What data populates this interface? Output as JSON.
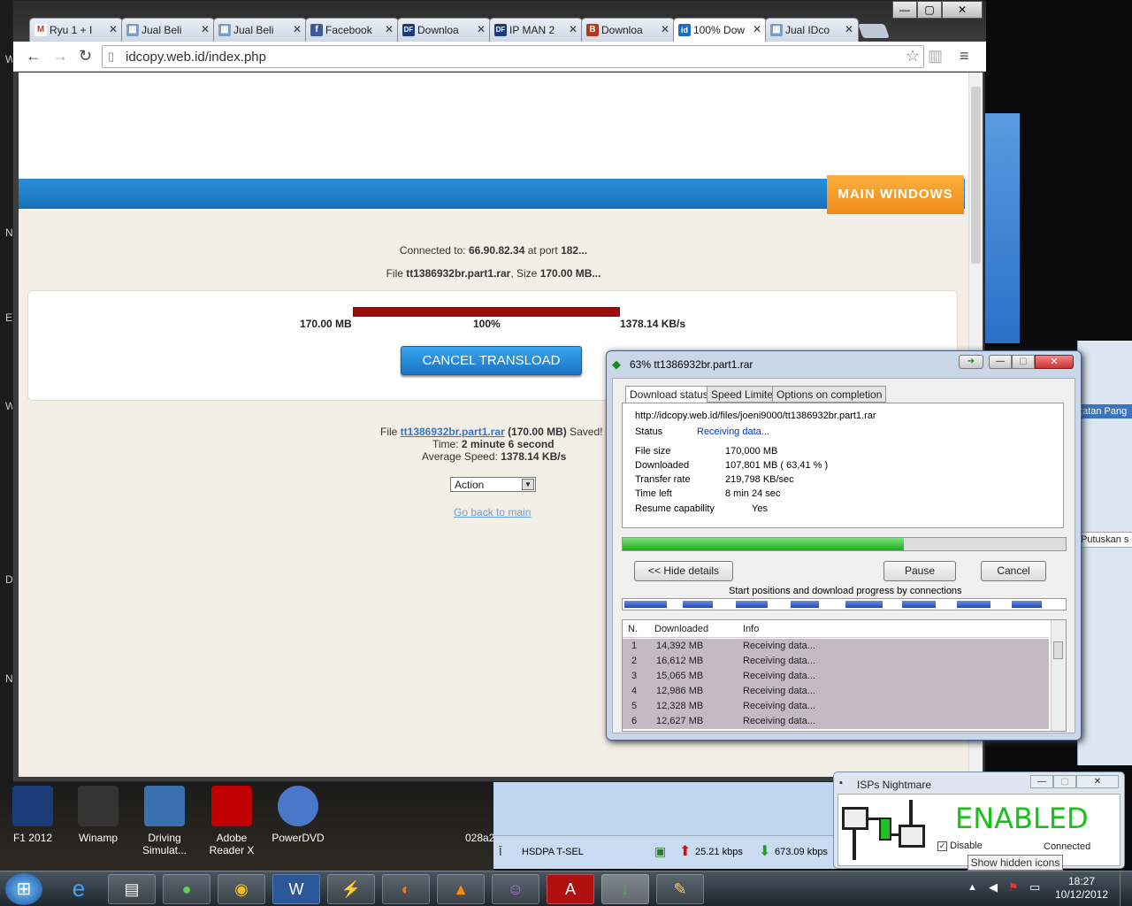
{
  "desktop": {
    "side_letters": [
      "W",
      "N",
      "E",
      "W",
      "D",
      "N"
    ],
    "right_strip": {
      "text1": "tatan Pang",
      "text2": "Putuskan s"
    },
    "icons": [
      {
        "label": "F1 2012",
        "icon": "f1-2012-icon",
        "color": "#1b3c78"
      },
      {
        "label": "Winamp",
        "icon": "winamp-icon",
        "color": "#333"
      },
      {
        "label": "Driving Simulat...",
        "icon": "driving-simulator-icon",
        "color": "#3a6fb0"
      },
      {
        "label": "Adobe Reader X",
        "icon": "adobe-reader-icon",
        "color": "#c00000"
      },
      {
        "label": "PowerDVD",
        "icon": "powerdvd-icon",
        "color": "#4a78c8"
      }
    ],
    "partial_label": "028a2"
  },
  "browser": {
    "tabs": [
      {
        "title": "Ryu 1 + I",
        "icon": "gmail-icon",
        "color": "#d93025",
        "glyph": "M"
      },
      {
        "title": "Jual Beli",
        "icon": "idcopy-icon",
        "color": "#7a9cc6",
        "glyph": "▦"
      },
      {
        "title": "Jual Beli",
        "icon": "idcopy-icon",
        "color": "#7a9cc6",
        "glyph": "▦"
      },
      {
        "title": "Facebook",
        "icon": "facebook-icon",
        "color": "#3b5998",
        "glyph": "f"
      },
      {
        "title": "Downloa",
        "icon": "df-icon",
        "color": "#1a3a7a",
        "glyph": "DF"
      },
      {
        "title": "IP MAN 2",
        "icon": "df-icon",
        "color": "#1a3a7a",
        "glyph": "DF"
      },
      {
        "title": "Downloa",
        "icon": "bu-icon",
        "color": "#b23a1c",
        "glyph": "B"
      },
      {
        "title": "100% Dow",
        "icon": "id-icon",
        "color": "#1a6fc0",
        "glyph": "id",
        "active": true
      },
      {
        "title": "Jual IDco",
        "icon": "idcopy-icon",
        "color": "#7a9cc6",
        "glyph": "▦"
      }
    ],
    "window_buttons": {
      "minimize": "—",
      "maximize": "▢",
      "close": "✕"
    },
    "url": "idcopy.web.id/index.php"
  },
  "page": {
    "main_windows": "MAIN WINDOWS",
    "connected_prefix": "Connected to: ",
    "connected_host": "66.90.82.34",
    "connected_mid": " at port ",
    "connected_port": "182...",
    "file_prefix": "File ",
    "file_name": "tt1386932br.part1.rar",
    "file_size_text": ", Size ",
    "file_size": "170.00 MB...",
    "progress": {
      "size": "170.00 MB",
      "percent": "100%",
      "speed": "1378.14 KB/s",
      "fraction": 1.0
    },
    "cancel_label": "CANCEL TRANSLOAD",
    "saved_prefix": "File ",
    "saved_link": "tt1386932br.part1.rar",
    "saved_size": " (170.00 MB) ",
    "saved_suffix": "Saved!",
    "time_label": "Time: ",
    "time_value": "2 minute 6 second",
    "speed_label": "Average Speed: ",
    "speed_value": "1378.14 KB/s",
    "action_label": "Action",
    "back_link": "Go back to main"
  },
  "idm": {
    "title": "63% tt1386932br.part1.rar",
    "tabs": [
      "Download status",
      "Speed Limiter",
      "Options on completion"
    ],
    "url": "http://idcopy.web.id/files/joeni9000/tt1386932br.part1.rar",
    "status_label": "Status",
    "status_value": "Receiving data...",
    "fields": [
      {
        "label": "File size",
        "value": "170,000  MB"
      },
      {
        "label": "Downloaded",
        "value": "107,801  MB  ( 63,41 % )"
      },
      {
        "label": "Transfer rate",
        "value": "219,798  KB/sec"
      },
      {
        "label": "Time left",
        "value": "8 min 24 sec"
      }
    ],
    "resume_label": "Resume capability",
    "resume_value": "Yes",
    "progress_fraction": 0.6341,
    "hide_details": "<< Hide details",
    "pause": "Pause",
    "cancel": "Cancel",
    "connections_label": "Start positions and download progress by connections",
    "list_headers": [
      "N.",
      "Downloaded",
      "Info"
    ],
    "rows": [
      {
        "n": "1",
        "downloaded": "14,392  MB",
        "info": "Receiving data..."
      },
      {
        "n": "2",
        "downloaded": "16,612  MB",
        "info": "Receiving data..."
      },
      {
        "n": "3",
        "downloaded": "15,065  MB",
        "info": "Receiving data..."
      },
      {
        "n": "4",
        "downloaded": "12,986  MB",
        "info": "Receiving data..."
      },
      {
        "n": "5",
        "downloaded": "12,328  MB",
        "info": "Receiving data..."
      },
      {
        "n": "6",
        "downloaded": "12,627  MB",
        "info": "Receiving data..."
      }
    ]
  },
  "isp": {
    "title": "ISPs Nightmare",
    "status": "ENABLED",
    "disable_label": "Disable",
    "connected_label": "Connected",
    "status_color": "#17c117"
  },
  "netbar": {
    "connection": "HSDPA  T-SEL",
    "upload": "25.21 kbps",
    "download": "673.09 kbps"
  },
  "tray": {
    "hidden_icons": "Show hidden icons",
    "time": "18:27",
    "date": "10/12/2012"
  },
  "taskbar": {
    "start": "⊞",
    "apps": [
      {
        "name": "internet-explorer-icon",
        "glyph": "e"
      },
      {
        "name": "file-explorer-icon",
        "glyph": "▤"
      },
      {
        "name": "media-app-icon",
        "glyph": "●"
      },
      {
        "name": "chrome-icon",
        "glyph": "◉"
      },
      {
        "name": "word-icon",
        "glyph": "W"
      },
      {
        "name": "winamp-icon",
        "glyph": "⚡"
      },
      {
        "name": "firefox-icon",
        "glyph": "◐"
      },
      {
        "name": "vlc-icon",
        "glyph": "▲"
      },
      {
        "name": "yahoo-messenger-icon",
        "glyph": "☺"
      },
      {
        "name": "adobe-reader-icon",
        "glyph": "A"
      },
      {
        "name": "idm-icon",
        "glyph": "↓"
      },
      {
        "name": "paint-icon",
        "glyph": "✎"
      }
    ]
  }
}
